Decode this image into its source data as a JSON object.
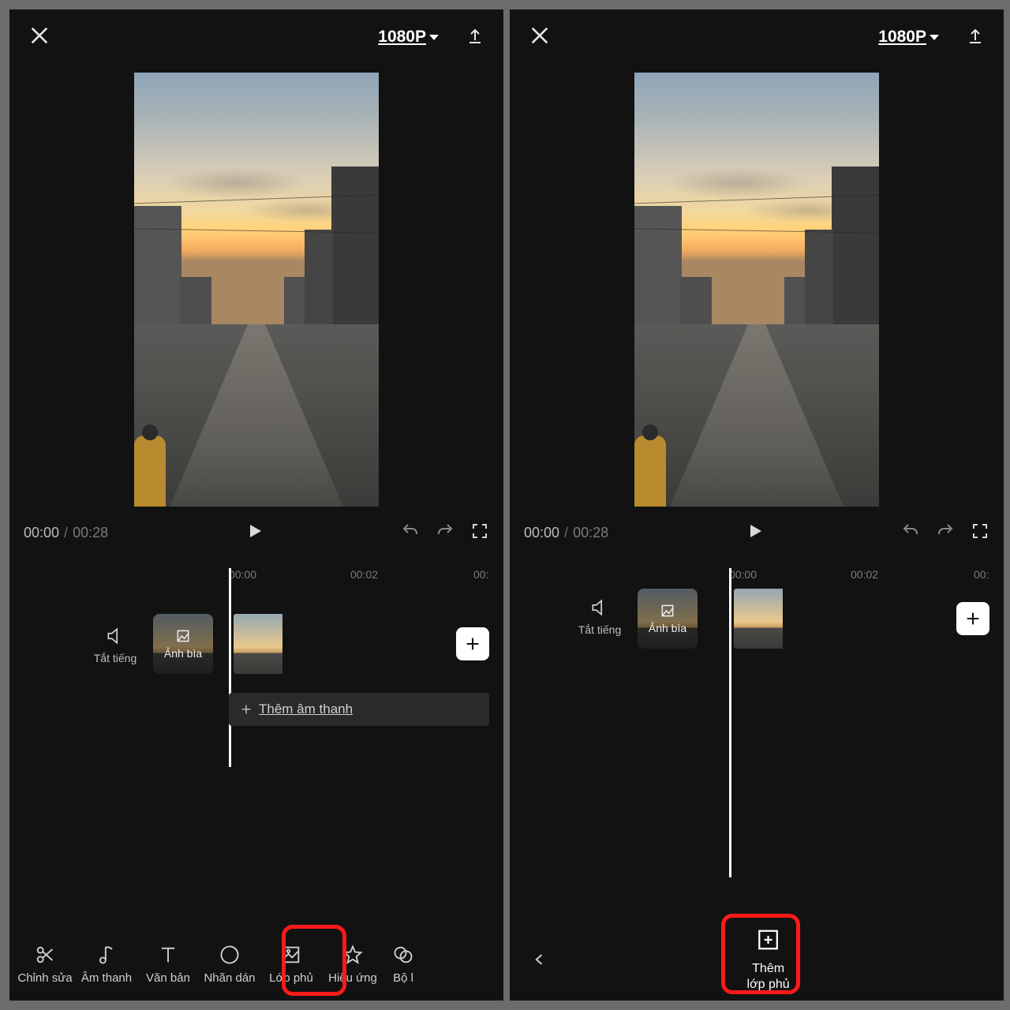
{
  "top": {
    "resolution": "1080P"
  },
  "transport": {
    "current": "00:00",
    "sep": "/",
    "duration": "00:28"
  },
  "ruler": {
    "t0": "00:00",
    "t1": "00:02",
    "t2": "00:"
  },
  "track": {
    "mute": "Tắt tiếng",
    "cover": "Ảnh bìa",
    "add_audio": "Thêm âm thanh"
  },
  "tools": {
    "edit": "Chỉnh sửa",
    "audio": "Âm thanh",
    "text": "Văn bản",
    "sticker": "Nhãn dán",
    "overlay": "Lớp phủ",
    "effect": "Hiệu ứng",
    "filter": "Bộ l"
  },
  "right_panel": {
    "add_overlay_line1": "Thêm",
    "add_overlay_line2": "lớp phủ"
  }
}
